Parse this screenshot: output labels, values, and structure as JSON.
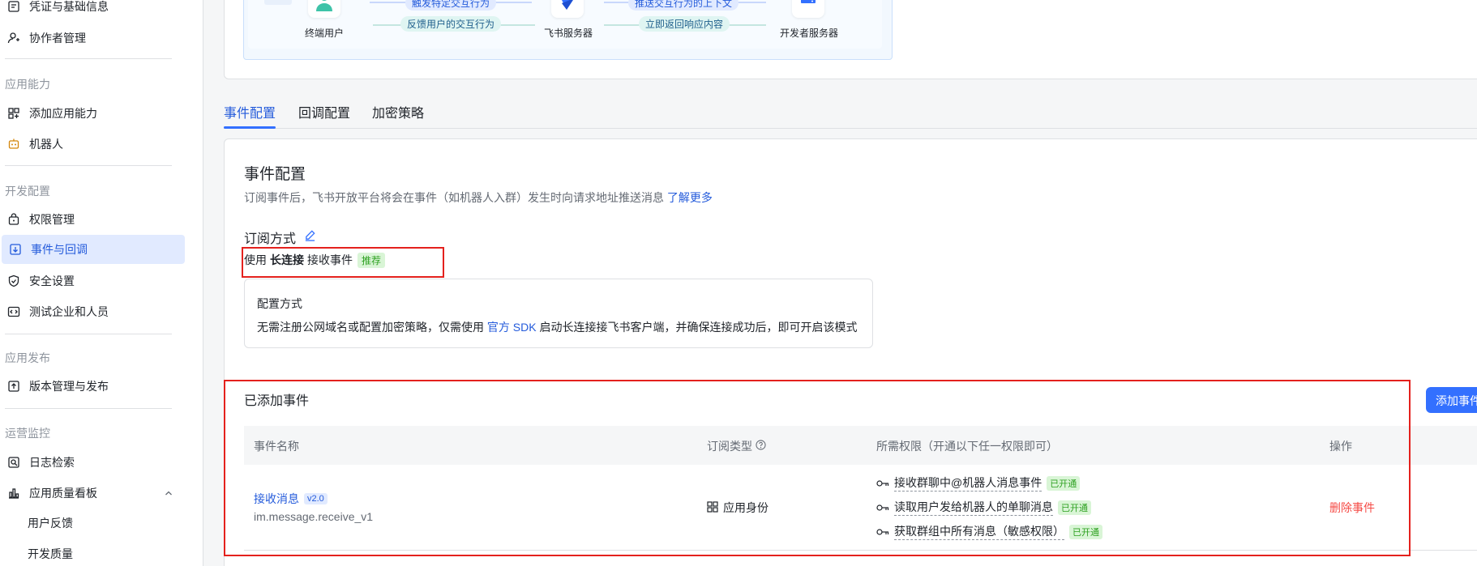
{
  "sidebar": {
    "items_top": [
      {
        "label": "凭证与基础信息",
        "icon": "credential-icon"
      },
      {
        "label": "协作者管理",
        "icon": "user-add-icon"
      }
    ],
    "group_capability": "应用能力",
    "items_capability": [
      {
        "label": "添加应用能力",
        "icon": "grid-add-icon"
      },
      {
        "label": "机器人",
        "icon": "robot-icon"
      }
    ],
    "group_dev": "开发配置",
    "items_dev": [
      {
        "label": "权限管理",
        "icon": "lock-icon"
      },
      {
        "label": "事件与回调",
        "icon": "event-icon"
      },
      {
        "label": "安全设置",
        "icon": "shield-icon"
      },
      {
        "label": "测试企业和人员",
        "icon": "code-icon"
      }
    ],
    "group_release": "应用发布",
    "items_release": [
      {
        "label": "版本管理与发布",
        "icon": "upload-icon"
      }
    ],
    "group_ops": "运营监控",
    "items_ops": [
      {
        "label": "日志检索",
        "icon": "log-search-icon"
      },
      {
        "label": "应用质量看板",
        "icon": "chart-icon"
      },
      {
        "label": "用户反馈"
      },
      {
        "label": "开发质量"
      }
    ]
  },
  "diagram": {
    "end_user": "终端用户",
    "feishu_server": "飞书服务器",
    "dev_server": "开发者服务器",
    "flow_top_left": "触发特定交互行为",
    "flow_bottom_left": "反馈用户的交互行为",
    "flow_top_right": "推送交互行为的上下文",
    "flow_bottom_right": "立即返回响应内容"
  },
  "tabs": [
    "事件配置",
    "回调配置",
    "加密策略"
  ],
  "main": {
    "title": "事件配置",
    "desc": "订阅事件后，飞书开放平台将会在事件（如机器人入群）发生时向请求地址推送消息",
    "learn_more": "了解更多",
    "subscribe_title": "订阅方式",
    "use_prefix": "使用",
    "use_bold": "长连接",
    "use_suffix": "接收事件",
    "recommend_tag": "推荐",
    "cfg_title": "配置方式",
    "cfg_desc_a": "无需注册公网域名或配置加密策略，仅需使用",
    "cfg_link": "官方 SDK",
    "cfg_desc_b": "启动长连接接飞书客户端，并确保连接成功后，即可开启该模式",
    "added_title": "已添加事件",
    "add_button": "添加事件",
    "table": {
      "col_name": "事件名称",
      "col_type": "订阅类型",
      "col_perm": "所需权限（开通以下任一权限即可）",
      "col_action": "操作",
      "row": {
        "name": "接收消息",
        "version": "v2.0",
        "code": "im.message.receive_v1",
        "type": "应用身份",
        "perms": [
          {
            "label": "接收群聊中@机器人消息事件",
            "status": "已开通"
          },
          {
            "label": "读取用户发给机器人的单聊消息",
            "status": "已开通"
          },
          {
            "label": "获取群组中所有消息（敏感权限）",
            "status": "已开通"
          }
        ],
        "action": "删除事件"
      }
    }
  }
}
